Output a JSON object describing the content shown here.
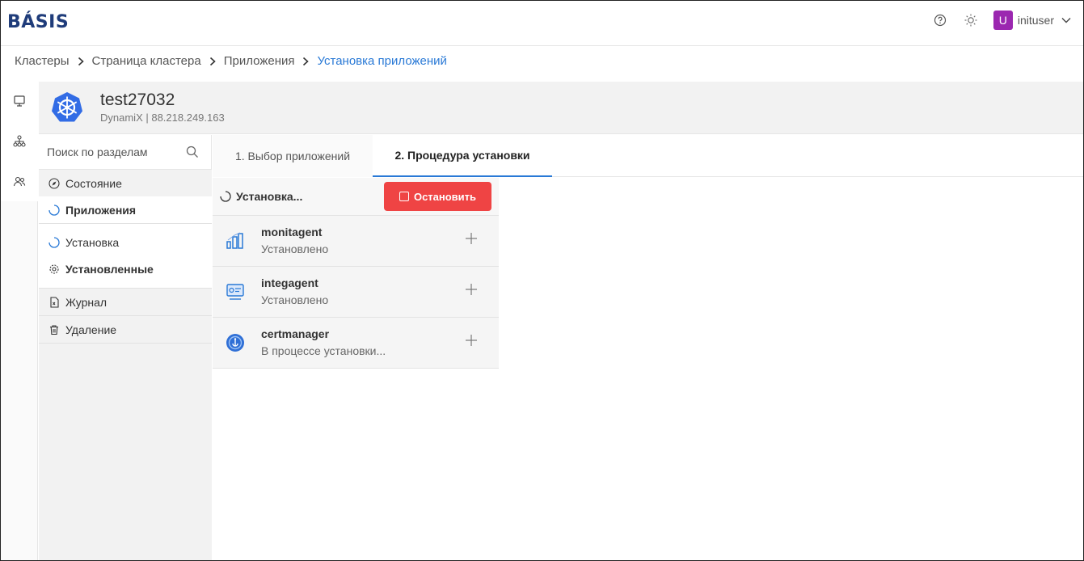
{
  "brand": {
    "logo_text": "BÁSIS"
  },
  "topbar": {
    "username": "inituser",
    "avatar_letter": "U"
  },
  "breadcrumb": [
    {
      "label": "Кластеры"
    },
    {
      "label": "Страница кластера"
    },
    {
      "label": "Приложения"
    },
    {
      "label": "Установка приложений"
    }
  ],
  "cluster": {
    "name": "test27032",
    "subtitle": "DynamiX | 88.218.249.163"
  },
  "menu": {
    "search_placeholder": "Поиск по разделам",
    "items": [
      {
        "label": "Состояние"
      },
      {
        "label": "Приложения"
      },
      {
        "label": "Установка"
      },
      {
        "label": "Установленные"
      },
      {
        "label": "Журнал"
      },
      {
        "label": "Удаление"
      }
    ]
  },
  "tabs": [
    {
      "label": "1. Выбор приложений"
    },
    {
      "label": "2. Процедура установки"
    }
  ],
  "install": {
    "status": "Установка...",
    "stop_label": "Остановить"
  },
  "apps": [
    {
      "name": "monitagent",
      "status": "Установлено"
    },
    {
      "name": "integagent",
      "status": "Установлено"
    },
    {
      "name": "certmanager",
      "status": "В процессе установки..."
    }
  ],
  "colors": {
    "accent": "#2979d6",
    "danger": "#ef4444",
    "avatar": "#9b27b0",
    "k8s": "#326ce5"
  }
}
